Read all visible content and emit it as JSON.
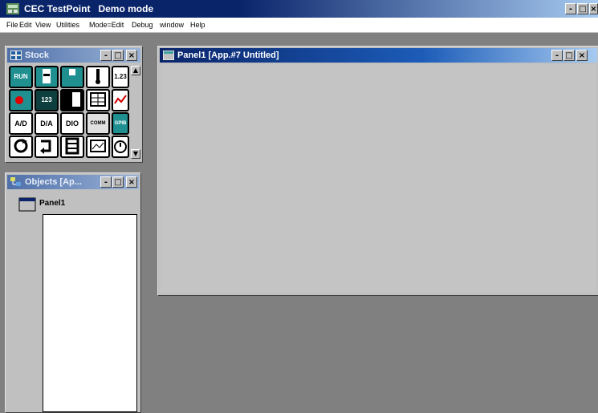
{
  "app": {
    "title": "CEC TestPoint   Demo mode",
    "controls": {
      "minimize": "-",
      "maximize": "□",
      "close": "×"
    }
  },
  "menubar": {
    "items": [
      "File",
      "Edit",
      "View",
      "Utilities",
      "Mode=Edit",
      "Debug",
      "window",
      "Help"
    ]
  },
  "stock": {
    "title": "Stock",
    "tools": [
      [
        "RUN",
        "",
        "",
        "",
        "1.23"
      ],
      [
        "",
        "123",
        "",
        "",
        ""
      ],
      [
        "A/D",
        "D/A",
        "DIO",
        "COMM",
        "GPIB"
      ],
      [
        "",
        "",
        "",
        "",
        ""
      ]
    ]
  },
  "objects": {
    "title": "Objects [Ap...",
    "tree_item": "Panel1"
  },
  "panel": {
    "title": "Panel1 [App.#7 Untitled]"
  },
  "colors": {
    "titlebar_active": "#0a246a",
    "window_face": "#c0c0c0",
    "mdi_background": "#808080",
    "tool_teal": "#1f8f8f"
  }
}
